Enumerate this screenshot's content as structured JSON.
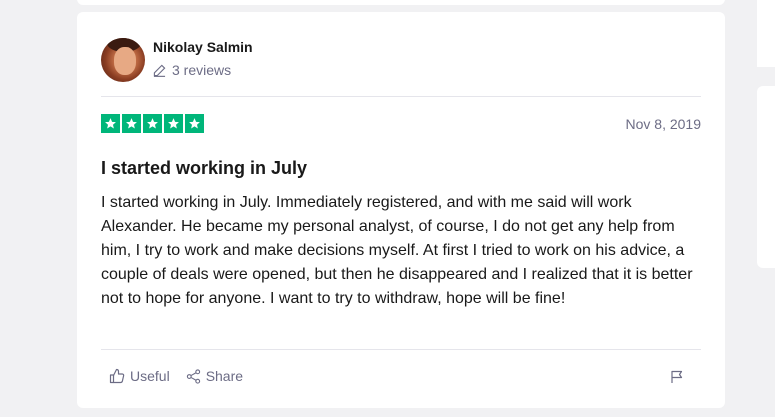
{
  "review": {
    "reviewer_name": "Nikolay Salmin",
    "reviews_count": "3 reviews",
    "rating": 5,
    "date": "Nov 8, 2019",
    "title": "I started working in July",
    "body": "I started working in July. Immediately registered, and with me said will work Alexander. He became my personal analyst, of course, I do not get any help from him, I try to work and make decisions myself. At first I tried to work on his advice, a couple of deals were opened, but then he disappeared and I realized that it is better not to hope for anyone. I want to try to withdraw, hope will be fine!"
  },
  "actions": {
    "useful_label": "Useful",
    "share_label": "Share"
  },
  "colors": {
    "star_green": "#00b67a",
    "muted_text": "#6c6c85"
  },
  "icons": [
    "pencil-icon",
    "star-icon",
    "thumbs-up-icon",
    "share-icon",
    "flag-icon"
  ]
}
